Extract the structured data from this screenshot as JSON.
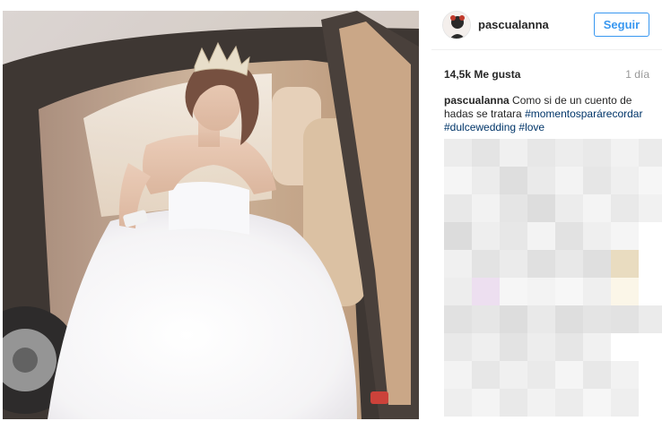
{
  "post": {
    "username": "pascualanna",
    "follow_label": "Seguir",
    "likes": "14,5k Me gusta",
    "time_ago": "1 día",
    "caption": {
      "user": "pascualanna",
      "text": "Como si de un cuento de hadas se tratara",
      "hashtags": [
        "#momentosparárecordar",
        "#dulcewedding",
        "#love"
      ]
    }
  },
  "colors": {
    "accent": "#3897f0",
    "hashtag": "#003569",
    "muted": "#999999",
    "text": "#262626"
  },
  "comments_mosaic": [
    [
      "#ececec",
      "#e4e4e4",
      "#f0f0f0",
      "#e7e7e7",
      "#ededed",
      "#e9e9e9",
      "#f2f2f2",
      "#ebebeb"
    ],
    [
      "#f5f5f5",
      "#ececec",
      "#dedede",
      "#eaeaea",
      "#f3f3f3",
      "#e6e6e6",
      "#efefef",
      "#f6f6f6"
    ],
    [
      "#e8e8e8",
      "#f2f2f2",
      "#e5e5e5",
      "#dddddd",
      "#ececec",
      "#f4f4f4",
      "#e9e9e9",
      "#f1f1f1"
    ],
    [
      "#dcdcdc",
      "#eeeeee",
      "#e7e7e7",
      "#f3f3f3",
      "#e2e2e2",
      "#efefef",
      "#f5f5f5",
      "#ffffff"
    ],
    [
      "#f0f0f0",
      "#e3e3e3",
      "#ebebeb",
      "#e0e0e0",
      "#e8e8e8",
      "#dfdfdf",
      "#e9dcc0",
      "#ffffff"
    ],
    [
      "#ededed",
      "#eddff0",
      "#f6f6f6",
      "#f3f3f3",
      "#f7f7f7",
      "#efefef",
      "#fbf6e8",
      "#ffffff"
    ],
    [
      "#e1e1e1",
      "#e6e6e6",
      "#dddddd",
      "#e9e9e9",
      "#dedede",
      "#e4e4e4",
      "#e2e2e2",
      "#ebebeb"
    ],
    [
      "#e9e9e9",
      "#efefef",
      "#e3e3e3",
      "#ededed",
      "#e6e6e6",
      "#f1f1f1",
      "#ffffff",
      "#ffffff"
    ],
    [
      "#f3f3f3",
      "#e7e7e7",
      "#f0f0f0",
      "#eaeaea",
      "#f5f5f5",
      "#e8e8e8",
      "#f2f2f2",
      "#ffffff"
    ],
    [
      "#eeeeee",
      "#f4f4f4",
      "#e9e9e9",
      "#f2f2f2",
      "#ececec",
      "#f6f6f6",
      "#eeeeee",
      "#ffffff"
    ]
  ]
}
